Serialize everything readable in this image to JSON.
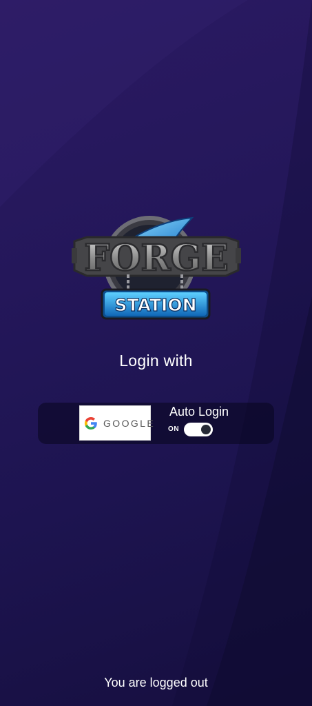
{
  "logo": {
    "top_text": "FORGE",
    "bottom_text": "STATION"
  },
  "login": {
    "title": "Login with",
    "google_button_label": "GOOGLE",
    "auto_login_label": "Auto Login",
    "auto_login_state": "ON",
    "auto_login_enabled": true
  },
  "status": {
    "message": "You are logged out"
  },
  "colors": {
    "background_top": "#2b1a63",
    "background_bottom": "#160f3f",
    "panel": "#0a0620",
    "station_blue": "#2ea8f0"
  }
}
